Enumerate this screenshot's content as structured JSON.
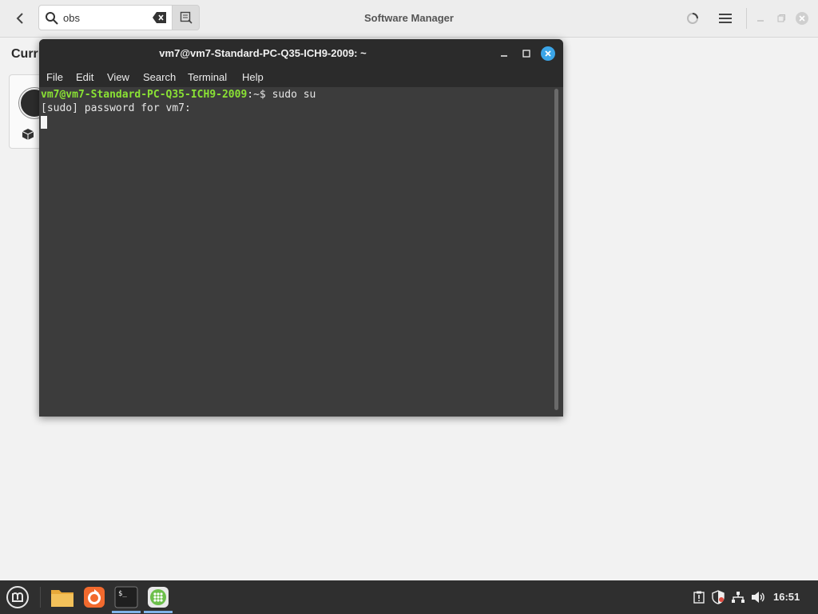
{
  "software_manager": {
    "title": "Software Manager",
    "search_value": "obs",
    "section_title": "Curr"
  },
  "terminal": {
    "title": "vm7@vm7-Standard-PC-Q35-ICH9-2009: ~",
    "menu": [
      "File",
      "Edit",
      "View",
      "Search",
      "Terminal",
      "Help"
    ],
    "lines": {
      "prompt_user": "vm7@vm7-Standard-PC-Q35-ICH9-2009",
      "prompt_sep": ":~$ ",
      "command": "sudo su",
      "output": "[sudo] password for vm7:"
    }
  },
  "taskbar": {
    "clock": "16:51",
    "apps": [
      "mint-menu-icon",
      "files-folder-icon",
      "firefox-icon",
      "terminal-icon",
      "software-manager-icon"
    ],
    "active_color": "#7fb3e8"
  },
  "colors": {
    "prompt_green": "#8ae234",
    "close_blue": "#3ba5e8",
    "terminal_bg": "#3c3c3c",
    "taskbar_bg": "#2f2f2f"
  }
}
